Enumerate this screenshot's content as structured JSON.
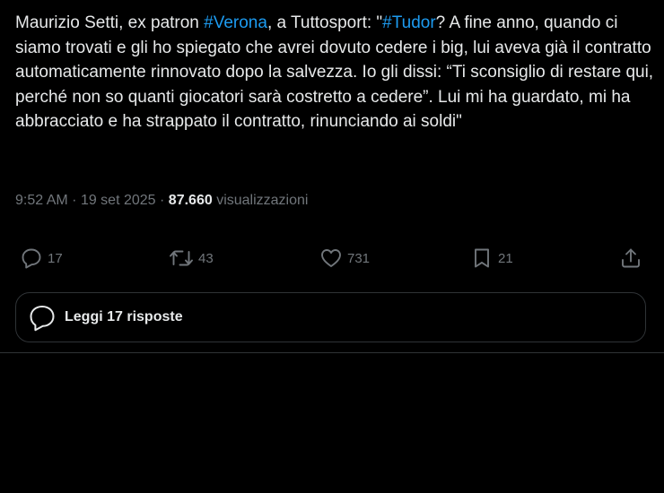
{
  "tweet": {
    "text_parts": [
      {
        "text": "Maurizio Setti, ex patron ",
        "type": "plain"
      },
      {
        "text": "#Verona",
        "type": "hashtag"
      },
      {
        "text": ", a Tuttosport: \"",
        "type": "plain"
      },
      {
        "text": "#Tudor",
        "type": "hashtag"
      },
      {
        "text": "? A fine anno, quando ci siamo trovati e gli ho spiegato che avrei dovuto cedere i big, lui aveva già il contratto automaticamente rinnovato dopo la salvezza. Io gli dissi: “Ti sconsiglio di restare qui, perché non so quanti giocatori sarà costretto a cedere”. Lui mi ha guardato, mi ha abbracciato e ha strappato il contratto, rinunciando ai soldi\"",
        "type": "plain"
      }
    ],
    "time": "9:52 AM",
    "separator": "·",
    "date": "19 set 2025",
    "views_count": "87.660",
    "views_label": "visualizzazioni"
  },
  "actions": {
    "replies": {
      "count": "17",
      "icon": "reply-icon"
    },
    "retweets": {
      "count": "43",
      "icon": "retweet-icon"
    },
    "likes": {
      "count": "731",
      "icon": "heart-icon"
    },
    "bookmarks": {
      "count": "21",
      "icon": "bookmark-icon"
    },
    "share": {
      "icon": "share-icon"
    }
  },
  "read_replies": {
    "label": "Leggi 17 risposte",
    "icon": "reply-bubble-icon"
  },
  "colors": {
    "background": "#000000",
    "text": "#e7e9ea",
    "secondary": "#71767b",
    "hashtag": "#1d9bf0",
    "border": "#2f3336"
  }
}
